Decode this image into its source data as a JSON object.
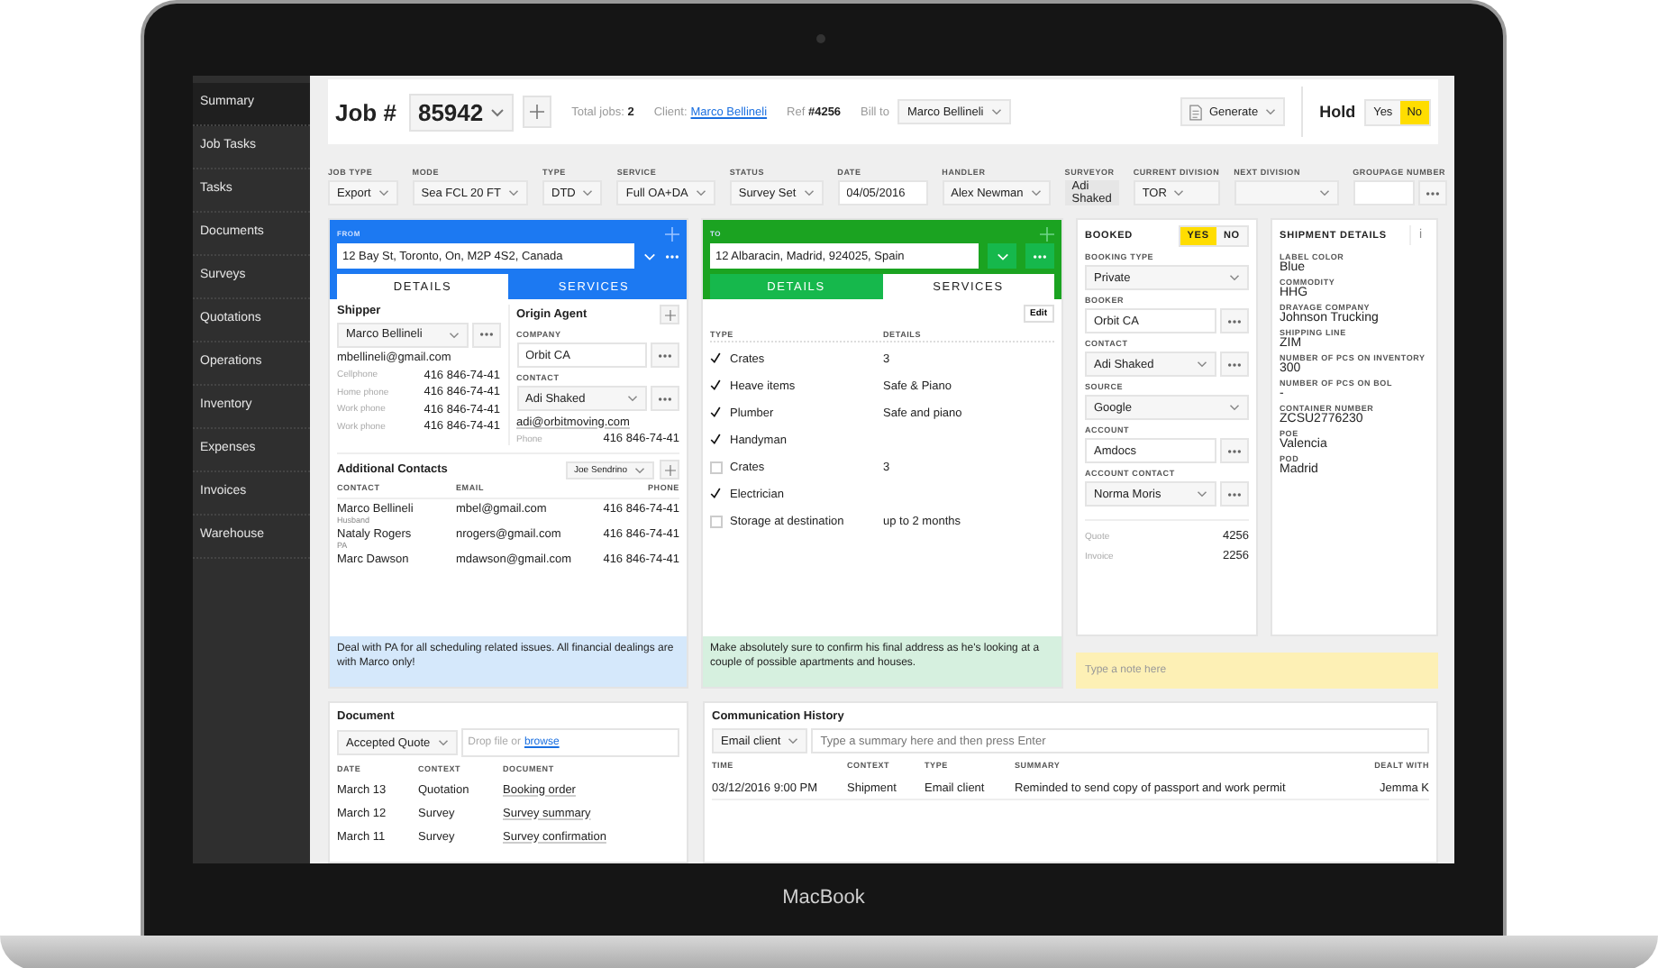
{
  "sidebar": {
    "items": [
      {
        "label": "Summary",
        "selected": true
      },
      {
        "label": "Job Tasks",
        "selected": false
      },
      {
        "label": "Tasks",
        "selected": false
      },
      {
        "label": "Documents",
        "selected": false
      },
      {
        "label": "Surveys",
        "selected": false
      },
      {
        "label": "Quotations",
        "selected": false
      },
      {
        "label": "Operations",
        "selected": false
      },
      {
        "label": "Inventory",
        "selected": false
      },
      {
        "label": "Expenses",
        "selected": false
      },
      {
        "label": "Invoices",
        "selected": false
      },
      {
        "label": "Warehouse",
        "selected": false
      }
    ]
  },
  "header": {
    "job_label": "Job #",
    "job_number": "85942",
    "total_jobs_label": "Total jobs:",
    "total_jobs": "2",
    "client_label": "Client:",
    "client": "Marco Bellineli",
    "ref_label": "Ref",
    "ref": "#4256",
    "bill_to_label": "Bill to",
    "bill_to": "Marco Bellineli",
    "generate": "Generate",
    "hold_label": "Hold",
    "hold_options": [
      {
        "label": "Yes",
        "selected": false
      },
      {
        "label": "No",
        "selected": true
      }
    ]
  },
  "fields": [
    {
      "label": "JOB TYPE",
      "value": "Export",
      "kind": "dropdown"
    },
    {
      "label": "MODE",
      "value": "Sea FCL 20 FT",
      "kind": "dropdown"
    },
    {
      "label": "TYPE",
      "value": "DTD",
      "kind": "dropdown"
    },
    {
      "label": "SERVICE",
      "value": "Full OA+DA",
      "kind": "dropdown"
    },
    {
      "label": "STATUS",
      "value": "Survey Set",
      "kind": "dropdown"
    },
    {
      "label": "DATE",
      "value": "04/05/2016",
      "kind": "input"
    },
    {
      "label": "HANDLER",
      "value": "Alex Newman",
      "kind": "dropdown"
    },
    {
      "label": "SURVEYOR",
      "value": "Adi Shaked",
      "kind": "readonly"
    },
    {
      "label": "CURRENT DIVISION",
      "value": "TOR",
      "kind": "dropdown"
    },
    {
      "label": "NEXT DIVISION",
      "kind": "dropdown"
    },
    {
      "label": "GROUPAGE NUMBER",
      "kind": "input_more"
    }
  ],
  "from": {
    "label": "FROM",
    "address": "12 Bay St, Toronto, On, M2P 4S2, Canada",
    "tabs": [
      {
        "label": "DETAILS",
        "selected": true
      },
      {
        "label": "SERVICES",
        "selected": false
      }
    ],
    "shipper": {
      "title": "Shipper",
      "name": "Marco Bellineli",
      "email": "mbellineli@gmail.com",
      "phones": [
        {
          "label": "Cellphone",
          "value": "416 846-74-41"
        },
        {
          "label": "Home phone",
          "value": "416 846-74-41"
        },
        {
          "label": "Work phone",
          "value": "416 846-74-41"
        },
        {
          "label": "Work phone",
          "value": "416 846-74-41"
        }
      ]
    },
    "origin_agent": {
      "title": "Origin Agent",
      "company_label": "COMPANY",
      "company": "Orbit CA",
      "contact_label": "CONTACT",
      "contact": "Adi Shaked",
      "email": "adi@orbitmoving.com",
      "phone_label": "Phone",
      "phone": "416 846-74-41"
    },
    "additional_contacts": {
      "title": "Additional Contacts",
      "selector": "Joe Sendrino",
      "columns": [
        "CONTACT",
        "EMAIL",
        "PHONE"
      ],
      "rows": [
        {
          "name": "Marco Bellineli",
          "role": "Husband",
          "email": "mbel@gmail.com",
          "phone": "416 846-74-41"
        },
        {
          "name": "Nataly Rogers",
          "role": "PA",
          "email": "nrogers@gmail.com",
          "phone": "416 846-74-41"
        },
        {
          "name": "Marc Dawson",
          "email": "mdawson@gmail.com",
          "phone": "416 846-74-41"
        }
      ]
    },
    "note": "Deal with PA for all scheduling related issues. All financial dealings are with Marco only!"
  },
  "to": {
    "label": "TO",
    "address": "12 Albaracin, Madrid, 924025, Spain",
    "tabs": [
      {
        "label": "DETAILS",
        "selected": false
      },
      {
        "label": "SERVICES",
        "selected": true
      }
    ],
    "edit": "Edit",
    "columns": [
      "TYPE",
      "DETAILS"
    ],
    "services": [
      {
        "type": "Crates",
        "details": "3",
        "checked": true
      },
      {
        "type": "Heave items",
        "details": "Safe & Piano",
        "checked": true
      },
      {
        "type": "Plumber",
        "details": "Safe and piano",
        "checked": true
      },
      {
        "type": "Handyman",
        "checked": true
      },
      {
        "type": "Crates",
        "details": "3",
        "checked": false
      },
      {
        "type": "Electrician",
        "checked": true
      },
      {
        "type": "Storage at destination",
        "details": "up to 2 months",
        "checked": false
      }
    ],
    "note": "Make absolutely sure to confirm his final address as he's looking at a couple of possible apartments and houses."
  },
  "booked": {
    "title": "BOOKED",
    "options": [
      {
        "label": "YES",
        "selected": true
      },
      {
        "label": "NO",
        "selected": false
      }
    ],
    "fields": [
      {
        "label": "BOOKING TYPE",
        "value": "Private",
        "kind": "dropdown"
      },
      {
        "label": "BOOKER",
        "value": "Orbit CA",
        "kind": "input_more"
      },
      {
        "label": "CONTACT",
        "value": "Adi Shaked",
        "kind": "dropdown_more"
      },
      {
        "label": "SOURCE",
        "value": "Google",
        "kind": "dropdown"
      },
      {
        "label": "ACCOUNT",
        "value": "Amdocs",
        "kind": "input_more"
      },
      {
        "label": "ACCOUNT CONTACT",
        "value": "Norma Moris",
        "kind": "dropdown_more"
      }
    ],
    "totals": [
      {
        "label": "Quote",
        "value": "4256"
      },
      {
        "label": "Invoice",
        "value": "2256"
      }
    ]
  },
  "shipment_details": {
    "title": "SHIPMENT DETAILS",
    "info": "i",
    "items": [
      {
        "label": "LABEL COLOR",
        "value": "Blue"
      },
      {
        "label": "COMMODITY",
        "value": "HHG"
      },
      {
        "label": "DRAYAGE COMPANY",
        "value": "Johnson Trucking"
      },
      {
        "label": "SHIPPING LINE",
        "value": "ZIM"
      },
      {
        "label": "NUMBER OF PCS ON INVENTORY",
        "value": "300"
      },
      {
        "label": "NUMBER OF PCS ON BOL",
        "value": "-"
      },
      {
        "label": "CONTAINER NUMBER",
        "value": "ZCSU2776230"
      },
      {
        "label": "POE",
        "value": "Valencia"
      },
      {
        "label": "POD",
        "value": "Madrid"
      }
    ]
  },
  "note_field": {
    "placeholder": "Type a note here"
  },
  "document": {
    "title": "Document",
    "type": "Accepted Quote",
    "drop_text": "Drop file or",
    "browse": "browse",
    "columns": [
      "DATE",
      "CONTEXT",
      "DOCUMENT"
    ],
    "rows": [
      [
        "March 13",
        "Quotation",
        "Booking order"
      ],
      [
        "March 12",
        "Survey",
        "Survey summary"
      ],
      [
        "March 11",
        "Survey",
        "Survey confirmation"
      ]
    ]
  },
  "communication": {
    "title": "Communication History",
    "type": "Email client",
    "placeholder": "Type a summary here and then press Enter",
    "columns": [
      "TIME",
      "CONTEXT",
      "TYPE",
      "SUMMARY",
      "DEALT WITH"
    ],
    "rows": [
      [
        "03/12/2016 9:00 PM",
        "Shipment",
        "Email client",
        "Reminded to send copy of passport and work permit",
        "Jemma K"
      ]
    ]
  },
  "device": {
    "label": "MacBook"
  }
}
